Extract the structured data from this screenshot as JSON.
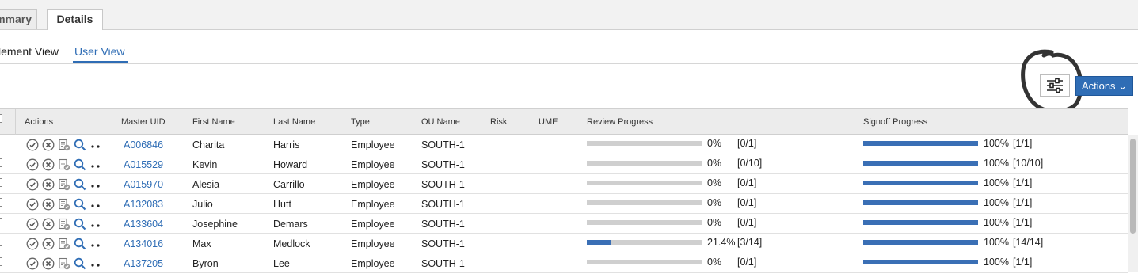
{
  "tabs": [
    {
      "label": "mmary"
    },
    {
      "label": "Details"
    }
  ],
  "subtabs": [
    {
      "label": "lement View"
    },
    {
      "label": "User View"
    }
  ],
  "toolbar": {
    "actions_label": "Actions ⌄"
  },
  "table": {
    "headers": [
      "Actions",
      "Master UID",
      "First Name",
      "Last Name",
      "Type",
      "OU Name",
      "Risk",
      "UME",
      "Review Progress",
      "Signoff Progress"
    ],
    "rows": [
      {
        "uid": "A006846",
        "first": "Charita",
        "last": "Harris",
        "type": "Employee",
        "ou": "SOUTH-1",
        "review_pct": "0%",
        "review_cnt": "[0/1]",
        "review_value": 0,
        "signoff_pct": "100%",
        "signoff_cnt": "[1/1]",
        "signoff_value": 100
      },
      {
        "uid": "A015529",
        "first": "Kevin",
        "last": "Howard",
        "type": "Employee",
        "ou": "SOUTH-1",
        "review_pct": "0%",
        "review_cnt": "[0/10]",
        "review_value": 0,
        "signoff_pct": "100%",
        "signoff_cnt": "[10/10]",
        "signoff_value": 100
      },
      {
        "uid": "A015970",
        "first": "Alesia",
        "last": "Carrillo",
        "type": "Employee",
        "ou": "SOUTH-1",
        "review_pct": "0%",
        "review_cnt": "[0/1]",
        "review_value": 0,
        "signoff_pct": "100%",
        "signoff_cnt": "[1/1]",
        "signoff_value": 100
      },
      {
        "uid": "A132083",
        "first": "Julio",
        "last": "Hutt",
        "type": "Employee",
        "ou": "SOUTH-1",
        "review_pct": "0%",
        "review_cnt": "[0/1]",
        "review_value": 0,
        "signoff_pct": "100%",
        "signoff_cnt": "[1/1]",
        "signoff_value": 100
      },
      {
        "uid": "A133604",
        "first": "Josephine",
        "last": "Demars",
        "type": "Employee",
        "ou": "SOUTH-1",
        "review_pct": "0%",
        "review_cnt": "[0/1]",
        "review_value": 0,
        "signoff_pct": "100%",
        "signoff_cnt": "[1/1]",
        "signoff_value": 100
      },
      {
        "uid": "A134016",
        "first": "Max",
        "last": "Medlock",
        "type": "Employee",
        "ou": "SOUTH-1",
        "review_pct": "21.4%",
        "review_cnt": "[3/14]",
        "review_value": 21.4,
        "signoff_pct": "100%",
        "signoff_cnt": "[14/14]",
        "signoff_value": 100
      },
      {
        "uid": "A137205",
        "first": "Byron",
        "last": "Lee",
        "type": "Employee",
        "ou": "SOUTH-1",
        "review_pct": "0%",
        "review_cnt": "[0/1]",
        "review_value": 0,
        "signoff_pct": "100%",
        "signoff_cnt": "[1/1]",
        "signoff_value": 100
      }
    ]
  },
  "row_icons": [
    "approve-icon",
    "reject-icon",
    "certify-document-icon",
    "search-icon",
    "more-icon"
  ],
  "colors": {
    "accent": "#2f6db5",
    "progress_fill": "#3a6fb5",
    "progress_track": "#cfcfcf",
    "annotation": "#333333"
  }
}
